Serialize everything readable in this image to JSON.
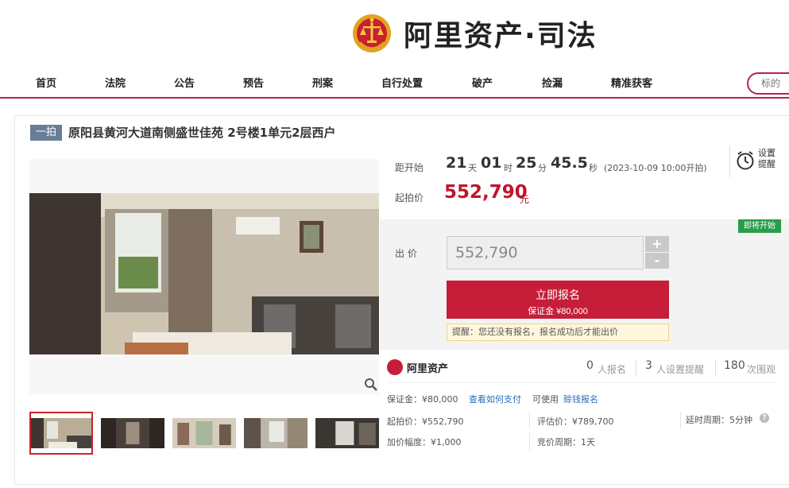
{
  "header": {
    "brand": "阿里资产·司法",
    "nav": [
      "首页",
      "法院",
      "公告",
      "预告",
      "刑案",
      "自行处置",
      "破产",
      "捡漏",
      "精准获客"
    ],
    "search_placeholder": "标的"
  },
  "item": {
    "round_badge": "一拍",
    "title": "原阳县黄河大道南侧盛世佳苑 2号楼1单元2层西户"
  },
  "countdown": {
    "label": "距开始",
    "days": "21",
    "days_unit": "天",
    "hours": "01",
    "hours_unit": "时",
    "minutes": "25",
    "minutes_unit": "分",
    "seconds": "45.5",
    "seconds_unit": "秒",
    "start_text": "(2023-10-09 10:00开拍)",
    "reminder": "设置提醒"
  },
  "price": {
    "start_label": "起拍价",
    "start_value": "552,790",
    "start_unit": "元"
  },
  "bid": {
    "status": "即将开始",
    "label": "出 价",
    "value": "552,790",
    "plus": "+",
    "minus": "-",
    "signup_label": "立即报名",
    "deposit_line": "保证金 ¥80,000",
    "tip": "提醒：您还没有报名，报名成功后才能出价"
  },
  "stats": {
    "brand": "阿里资产",
    "signups": "0",
    "signups_label": "人报名",
    "reminders": "3",
    "reminders_label": "人设置提醒",
    "views": "180",
    "views_label": "次围观"
  },
  "details": {
    "deposit": "保证金：¥80,000",
    "how_to_pay": "查看如何支付",
    "can_use": "可使用",
    "credit_signup": "赊钱报名",
    "start_price": "起拍价：¥552,790",
    "appraisal": "评估价：¥789,700",
    "delay_period": "延时周期：5分钟",
    "increment": "加价幅度：¥1,000",
    "bid_period": "竞价周期：1天"
  },
  "colors": {
    "brand_red": "#c61e38",
    "price_red": "#c0152b",
    "status_green": "#2a9d48",
    "link_blue": "#2a6bb8"
  }
}
